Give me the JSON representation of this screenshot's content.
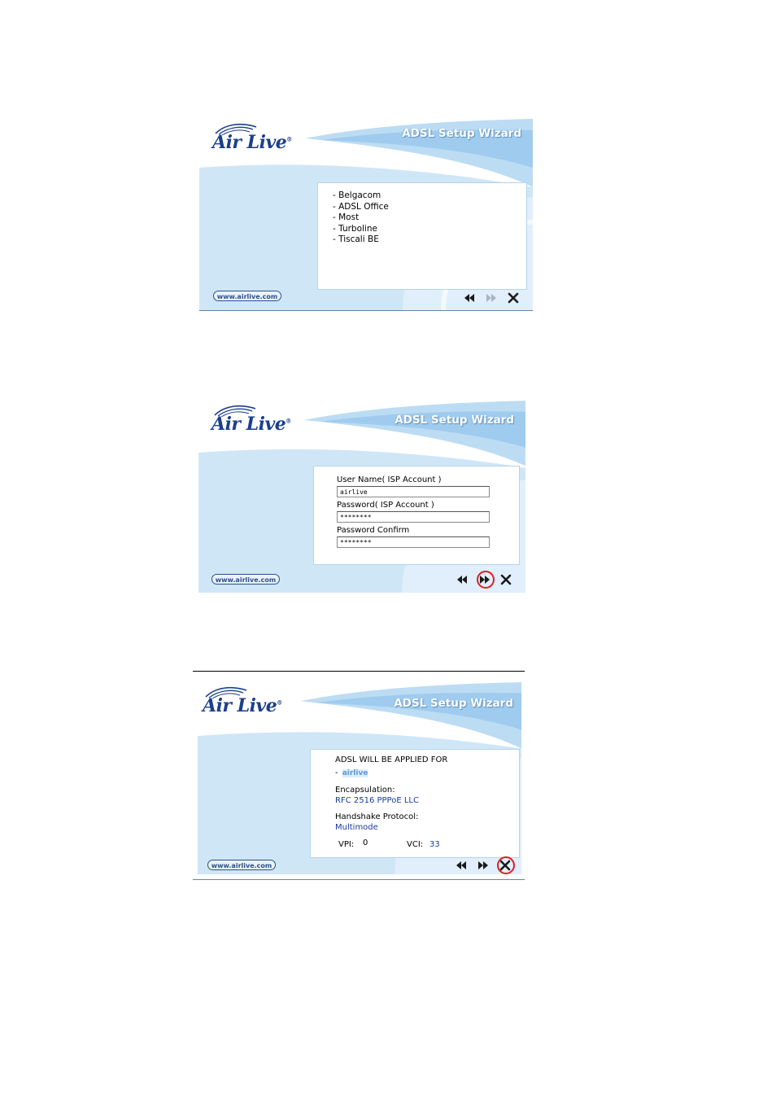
{
  "wizard": {
    "brand": "Air Live",
    "brand_mark": "®",
    "title": "ADSL Setup Wizard",
    "url": "www.airlive.com"
  },
  "screens": [
    {
      "isp_list": [
        "- Belgacom",
        "- ADSL Office",
        "- Most",
        "- Turboline",
        "- Tiscali BE"
      ]
    },
    {
      "username_label": "User Name( ISP Account )",
      "username_value": "airlive",
      "password_label": "Password( ISP Account )",
      "password_value": "********",
      "confirm_label": "Password Confirm",
      "confirm_value": "********",
      "highlighted": "next"
    },
    {
      "applied_label": "ADSL WILL BE APPLIED FOR",
      "applied_prefix": "-",
      "applied_value": "airlive",
      "encap_label": "Encapsulation:",
      "encap_value": "RFC 2516 PPPoE LLC",
      "handshake_label": "Handshake Protocol:",
      "handshake_value": "Multimode",
      "vpi_label": "VPI:",
      "vpi_value": "0",
      "vci_label": "VCI:",
      "vci_value": "33",
      "highlighted": "close"
    }
  ],
  "colors": {
    "sky": "#cfe6f7",
    "sky_dark": "#9fcbee",
    "brand_blue": "#1b3f8c",
    "highlight_red": "#e02020",
    "value_blue": "#1a3aa0"
  }
}
